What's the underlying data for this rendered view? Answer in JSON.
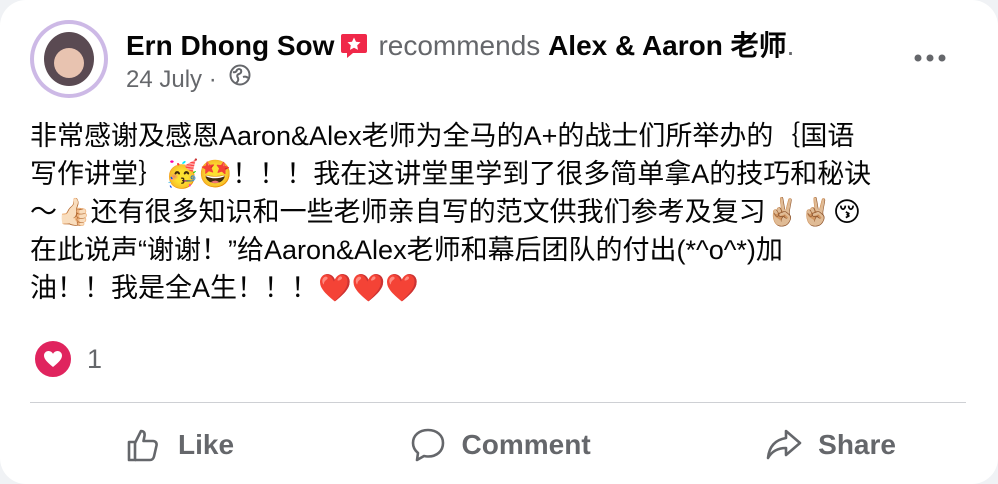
{
  "post": {
    "author": "Ern Dhong Sow",
    "verb": "recommends",
    "target": "Alex & Aaron 老师",
    "target_suffix": ".",
    "date": "24 July",
    "separator": "·",
    "privacy_icon": "globe-icon",
    "badge_icon": "recommend-badge-icon",
    "body_lines": [
      "非常感谢及感恩Aaron&Alex老师为全马的A+的战士们所举办的｛国语",
      "写作讲堂｝🥳🤩！！！我在这讲堂里学到了很多简单拿A的技巧和秘诀",
      "～👍🏻还有很多知识和一些老师亲自写的范文供我们参考及复习✌🏼✌🏼😚",
      "在此说声“谢谢！”给Aaron&Alex老师和幕后团队的付出(*^o^*)加",
      "油！！我是全A生！！！❤️❤️❤️"
    ],
    "reaction_icon": "heart-icon",
    "reaction_count": "1",
    "colors": {
      "text": "#050505",
      "secondary": "#65676b",
      "badge": "#f02849",
      "reaction": "#e0245e",
      "divider": "#ced0d4"
    }
  },
  "actions": {
    "like_label": "Like",
    "comment_label": "Comment",
    "share_label": "Share"
  }
}
